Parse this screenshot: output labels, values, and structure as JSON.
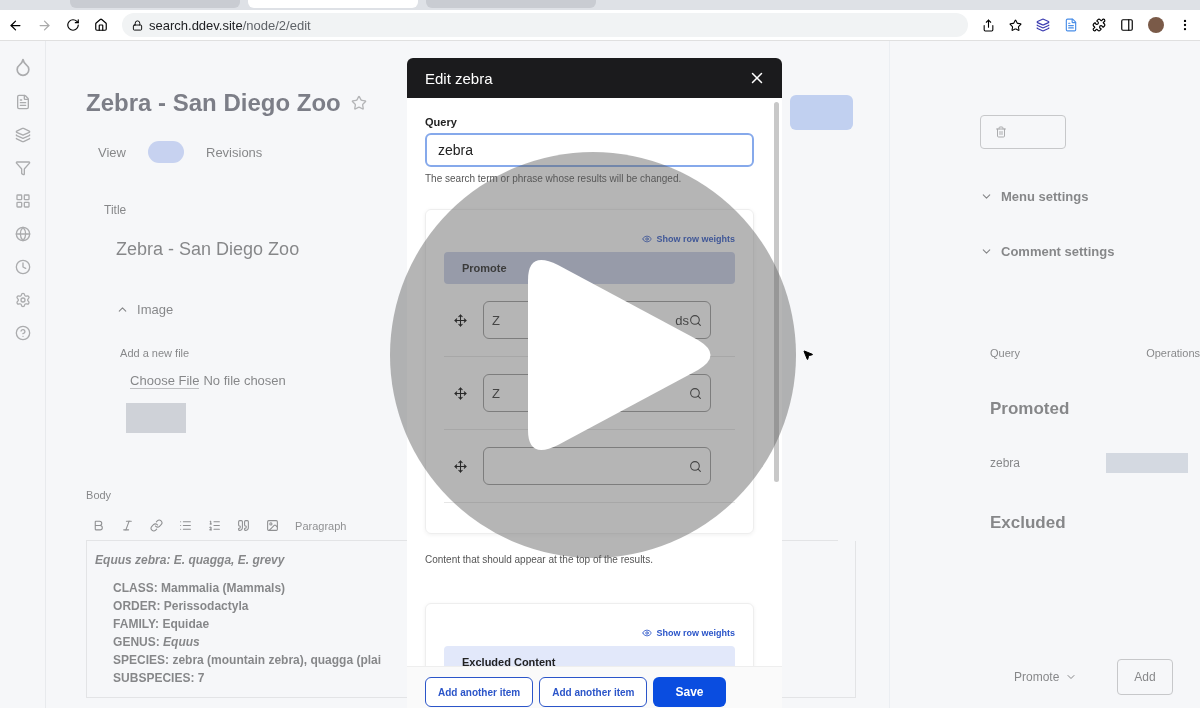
{
  "browser": {
    "tabs": [
      {
        "selected": false
      },
      {
        "selected": true
      },
      {
        "selected": false
      }
    ],
    "url_host": "search.ddev.site",
    "url_path": "/node/2/edit"
  },
  "page": {
    "title": "Zebra - San Diego Zoo",
    "tabs": [
      "View",
      "Revisions"
    ],
    "title_label": "Title",
    "title_value": "Zebra - San Diego Zoo",
    "image_section": "Image",
    "file_label": "Add a new file",
    "choose_file": "Choose File",
    "no_file": "No file chosen",
    "body_label": "Body",
    "format": "Paragraph",
    "body_lead": "Equus zebra: E. quagga, E. grevy",
    "body_lines": [
      "CLASS: Mammalia (Mammals)",
      "ORDER: Perissodactyla",
      "FAMILY: Equidae",
      "GENUS: *Equus*",
      "SPECIES: zebra (mountain zebra), quagga (plai",
      "SUBSPECIES: 7"
    ]
  },
  "sidebar": {
    "menu_settings": "Menu settings",
    "comment_settings": "Comment settings",
    "columns": [
      "Query",
      "Operations"
    ],
    "promoted_heading": "Promoted",
    "promoted_query": "zebra",
    "excluded_heading": "Excluded",
    "action_select": "Promote",
    "add_button": "Add"
  },
  "modal": {
    "title": "Edit zebra",
    "query_label": "Query",
    "query_value": "zebra",
    "query_help": "The search term or phrase whose results will be changed.",
    "sections": [
      {
        "kind": "promoted",
        "weights_link": "Show row weights",
        "header": "Promote",
        "rows": [
          {
            "text": "Z",
            "end_text": "ds"
          },
          {
            "text": "Z"
          },
          {}
        ],
        "help": "Content that should appear at the top of the results."
      },
      {
        "kind": "excluded",
        "weights_link": "Show row weights",
        "header": "Excluded Content"
      }
    ],
    "buttons": [
      {
        "label": "Add another item",
        "kind": "secondary"
      },
      {
        "label": "Add another item",
        "kind": "secondary"
      },
      {
        "label": "Save",
        "kind": "primary"
      }
    ]
  }
}
